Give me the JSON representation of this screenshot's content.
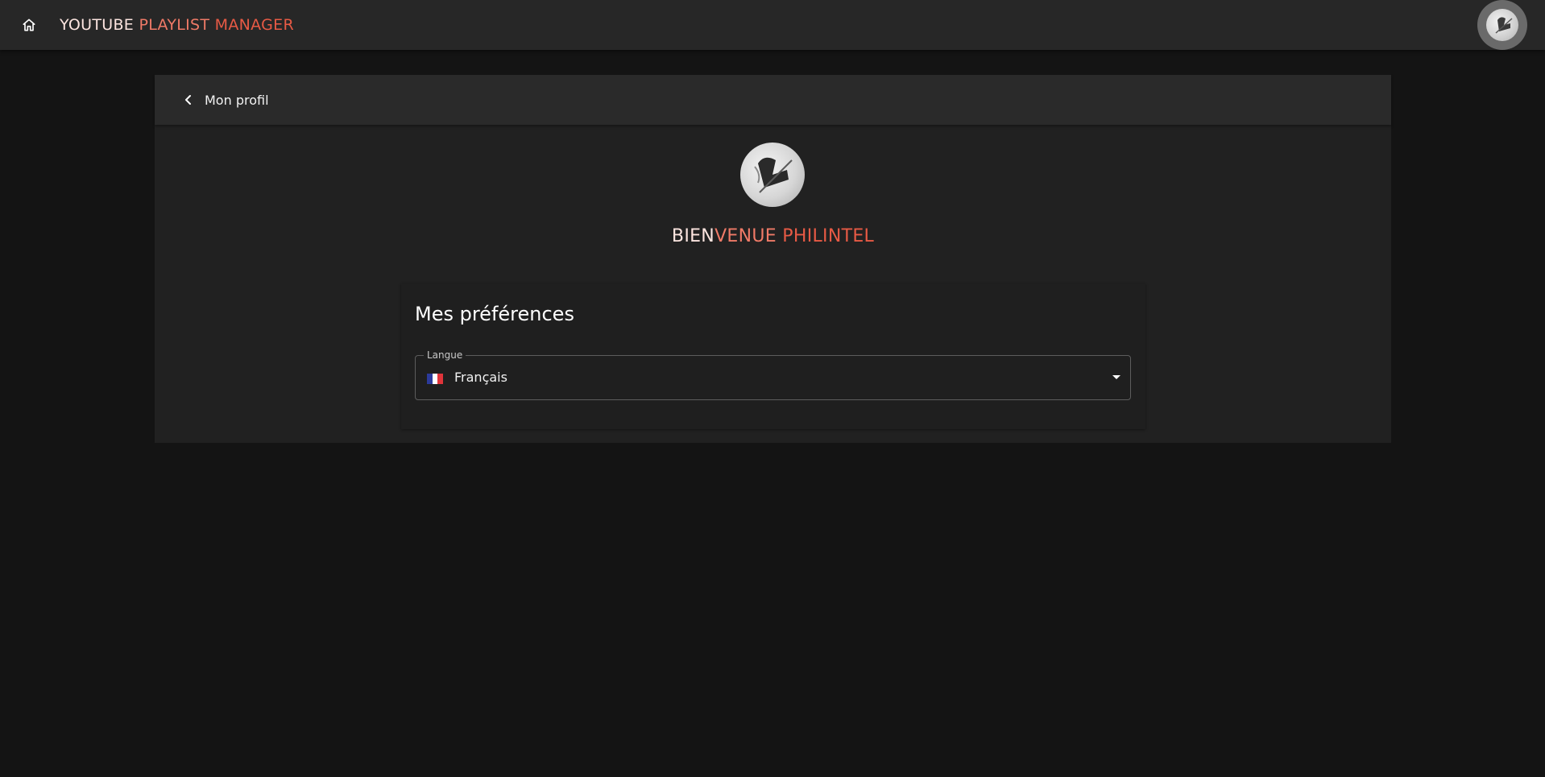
{
  "header": {
    "title_part1": "YOUTUBE",
    "title_part2": "PLAYLIST",
    "title_part3": "MANAGER",
    "home_icon": "home-icon",
    "avatar_icon": "user-avatar"
  },
  "profile": {
    "back_label": "Mon profil",
    "back_icon": "chevron-left-icon",
    "welcome_part1": "BIEN",
    "welcome_part2": "VENUE",
    "welcome_part3": "PHILINTEL"
  },
  "preferences": {
    "title": "Mes préférences",
    "language_label": "Langue",
    "language_value": "Français",
    "flag_icon": "france-flag-icon",
    "dropdown_icon": "caret-down-icon"
  },
  "colors": {
    "background": "#141414",
    "topbar": "#272727",
    "card": "#212121",
    "accent": "#e85a45",
    "accent_light": "#f07a67",
    "text_light": "#fde5e0"
  }
}
